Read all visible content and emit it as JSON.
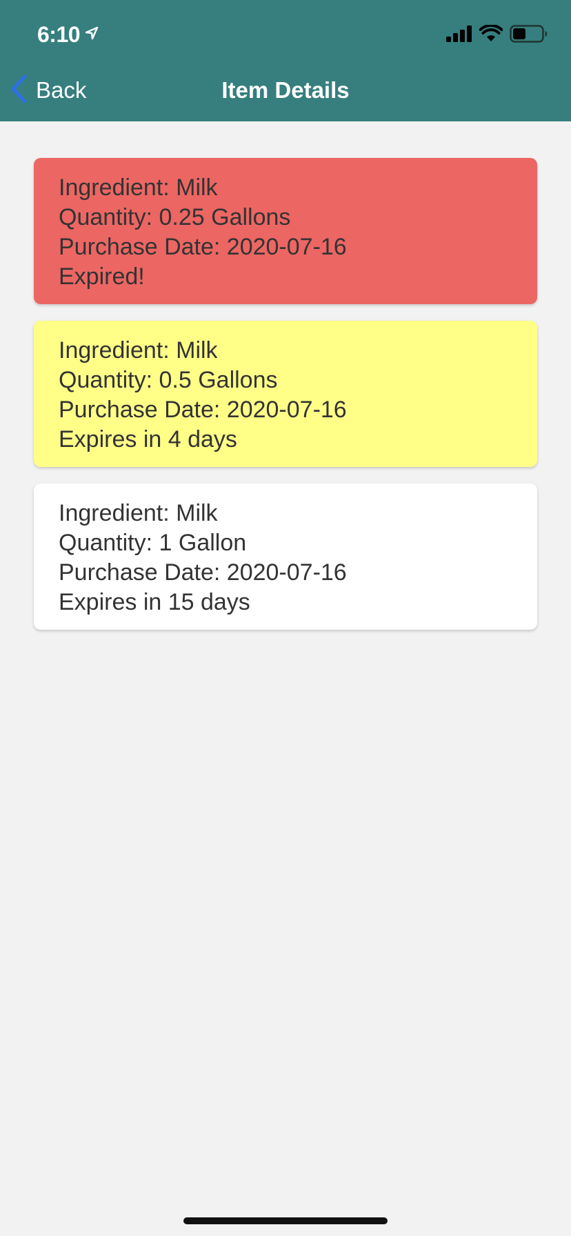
{
  "status_bar": {
    "time": "6:10",
    "location_icon": "location-arrow-icon",
    "signal_icon": "cellular-signal-icon",
    "wifi_icon": "wifi-icon",
    "battery_icon": "battery-icon",
    "battery_level": 0.45
  },
  "nav": {
    "back_label": "Back",
    "back_icon": "chevron-left-icon",
    "title": "Item Details"
  },
  "colors": {
    "header": "#367f7e",
    "background": "#f2f2f2",
    "back_chevron": "#2f6fe6",
    "expired": "#ec6663",
    "expiring_soon": "#ffff88",
    "fresh": "#ffffff"
  },
  "items": [
    {
      "ingredient": "Ingredient: Milk",
      "quantity": "Quantity: 0.25 Gallons",
      "purchase_date": "Purchase Date: 2020-07-16",
      "status": "Expired!",
      "color": "#ec6663"
    },
    {
      "ingredient": "Ingredient: Milk",
      "quantity": "Quantity: 0.5 Gallons",
      "purchase_date": "Purchase Date: 2020-07-16",
      "status": "Expires in 4 days",
      "color": "#ffff88"
    },
    {
      "ingredient": "Ingredient: Milk",
      "quantity": "Quantity: 1 Gallon",
      "purchase_date": "Purchase Date: 2020-07-16",
      "status": "Expires in 15 days",
      "color": "#ffffff"
    }
  ]
}
